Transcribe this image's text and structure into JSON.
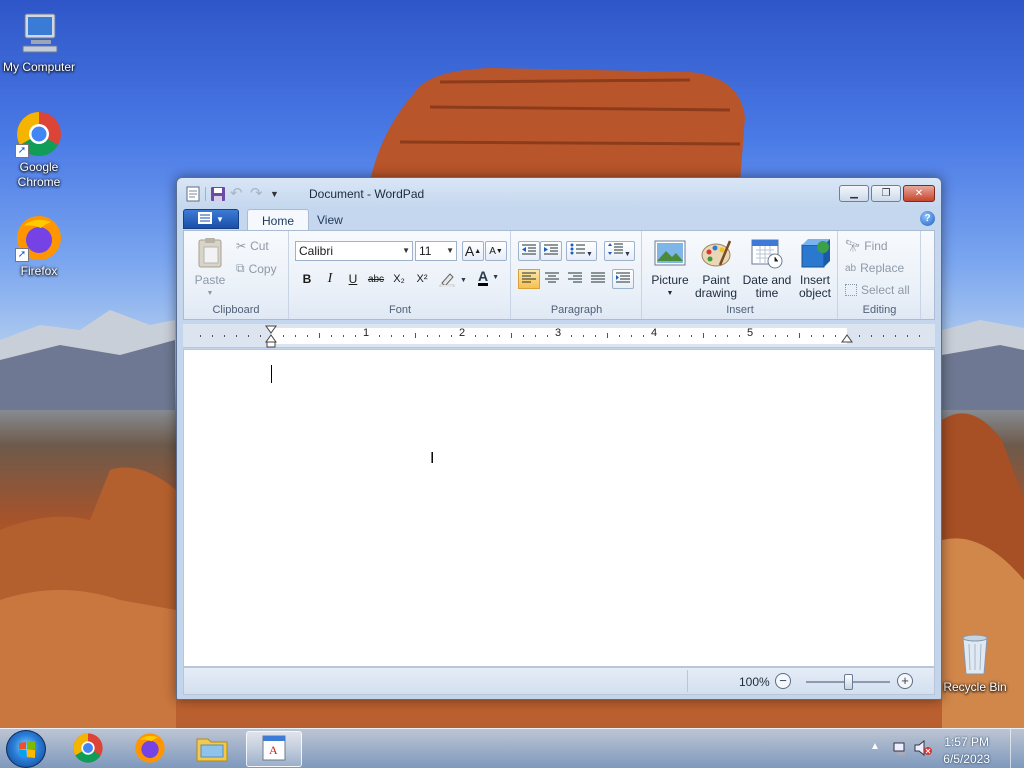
{
  "desktop": {
    "icons": [
      {
        "label": "My Computer",
        "icon": "computer-icon"
      },
      {
        "label": "Google Chrome",
        "icon": "chrome-icon"
      },
      {
        "label": "Firefox",
        "icon": "firefox-icon"
      },
      {
        "label": "Recycle Bin",
        "icon": "recycle-bin-icon"
      }
    ]
  },
  "window": {
    "title": "Document - WordPad",
    "tabs": [
      "Home",
      "View"
    ],
    "active_tab": "Home",
    "ribbon": {
      "clipboard": {
        "label": "Clipboard",
        "paste": "Paste",
        "cut": "Cut",
        "copy": "Copy"
      },
      "font": {
        "label": "Font",
        "family": "Calibri",
        "size": "11",
        "bold": "B",
        "italic": "I",
        "underline": "U",
        "strikethrough": "abc",
        "subscript": "X₂",
        "superscript": "X²",
        "grow": "A",
        "shrink": "A"
      },
      "paragraph": {
        "label": "Paragraph"
      },
      "insert": {
        "label": "Insert",
        "picture": "Picture",
        "paint_drawing_1": "Paint",
        "paint_drawing_2": "drawing",
        "date_time_1": "Date and",
        "date_time_2": "time",
        "insert_object_1": "Insert",
        "insert_object_2": "object"
      },
      "editing": {
        "label": "Editing",
        "find": "Find",
        "replace": "Replace",
        "select_all": "Select all"
      }
    },
    "ruler": {
      "numbers": [
        "1",
        "2",
        "3",
        "4",
        "5"
      ]
    },
    "status": {
      "zoom": "100%",
      "zoom_level": 1.0
    }
  },
  "taskbar": {
    "items": [
      "Start",
      "Google Chrome",
      "Firefox",
      "Windows Explorer",
      "WordPad"
    ],
    "active": "WordPad",
    "clock": {
      "time": "1:57 PM",
      "date": "6/5/2023"
    }
  }
}
